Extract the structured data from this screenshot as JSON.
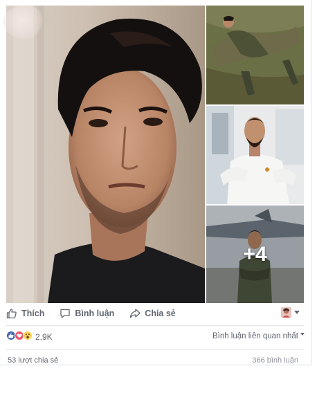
{
  "post": {
    "photos": [
      {
        "name": "main-photo",
        "subject": "portrait-dark-hair"
      },
      {
        "name": "thumb-1",
        "subject": "soldier-lying-on-grass"
      },
      {
        "name": "thumb-2",
        "subject": "man-in-white-kurta"
      },
      {
        "name": "thumb-3",
        "subject": "soldier-by-jet"
      }
    ],
    "more_photos_label": "+4"
  },
  "actions": {
    "like_label": "Thích",
    "comment_label": "Bình luận",
    "share_label": "Chia sẻ"
  },
  "reactions": {
    "icons": [
      "like-reaction-icon",
      "love-reaction-icon",
      "wow-reaction-icon"
    ],
    "count": "2,9K",
    "sort_label": "Bình luận liên quan nhất"
  },
  "stats": {
    "shares": "53 lượt chia sẻ",
    "comments": "366 bình luận"
  },
  "colors": {
    "like_blue": "#4267b2",
    "love_red": "#f25268",
    "wow_yellow": "#fcd25a",
    "text_gray": "#606770"
  }
}
